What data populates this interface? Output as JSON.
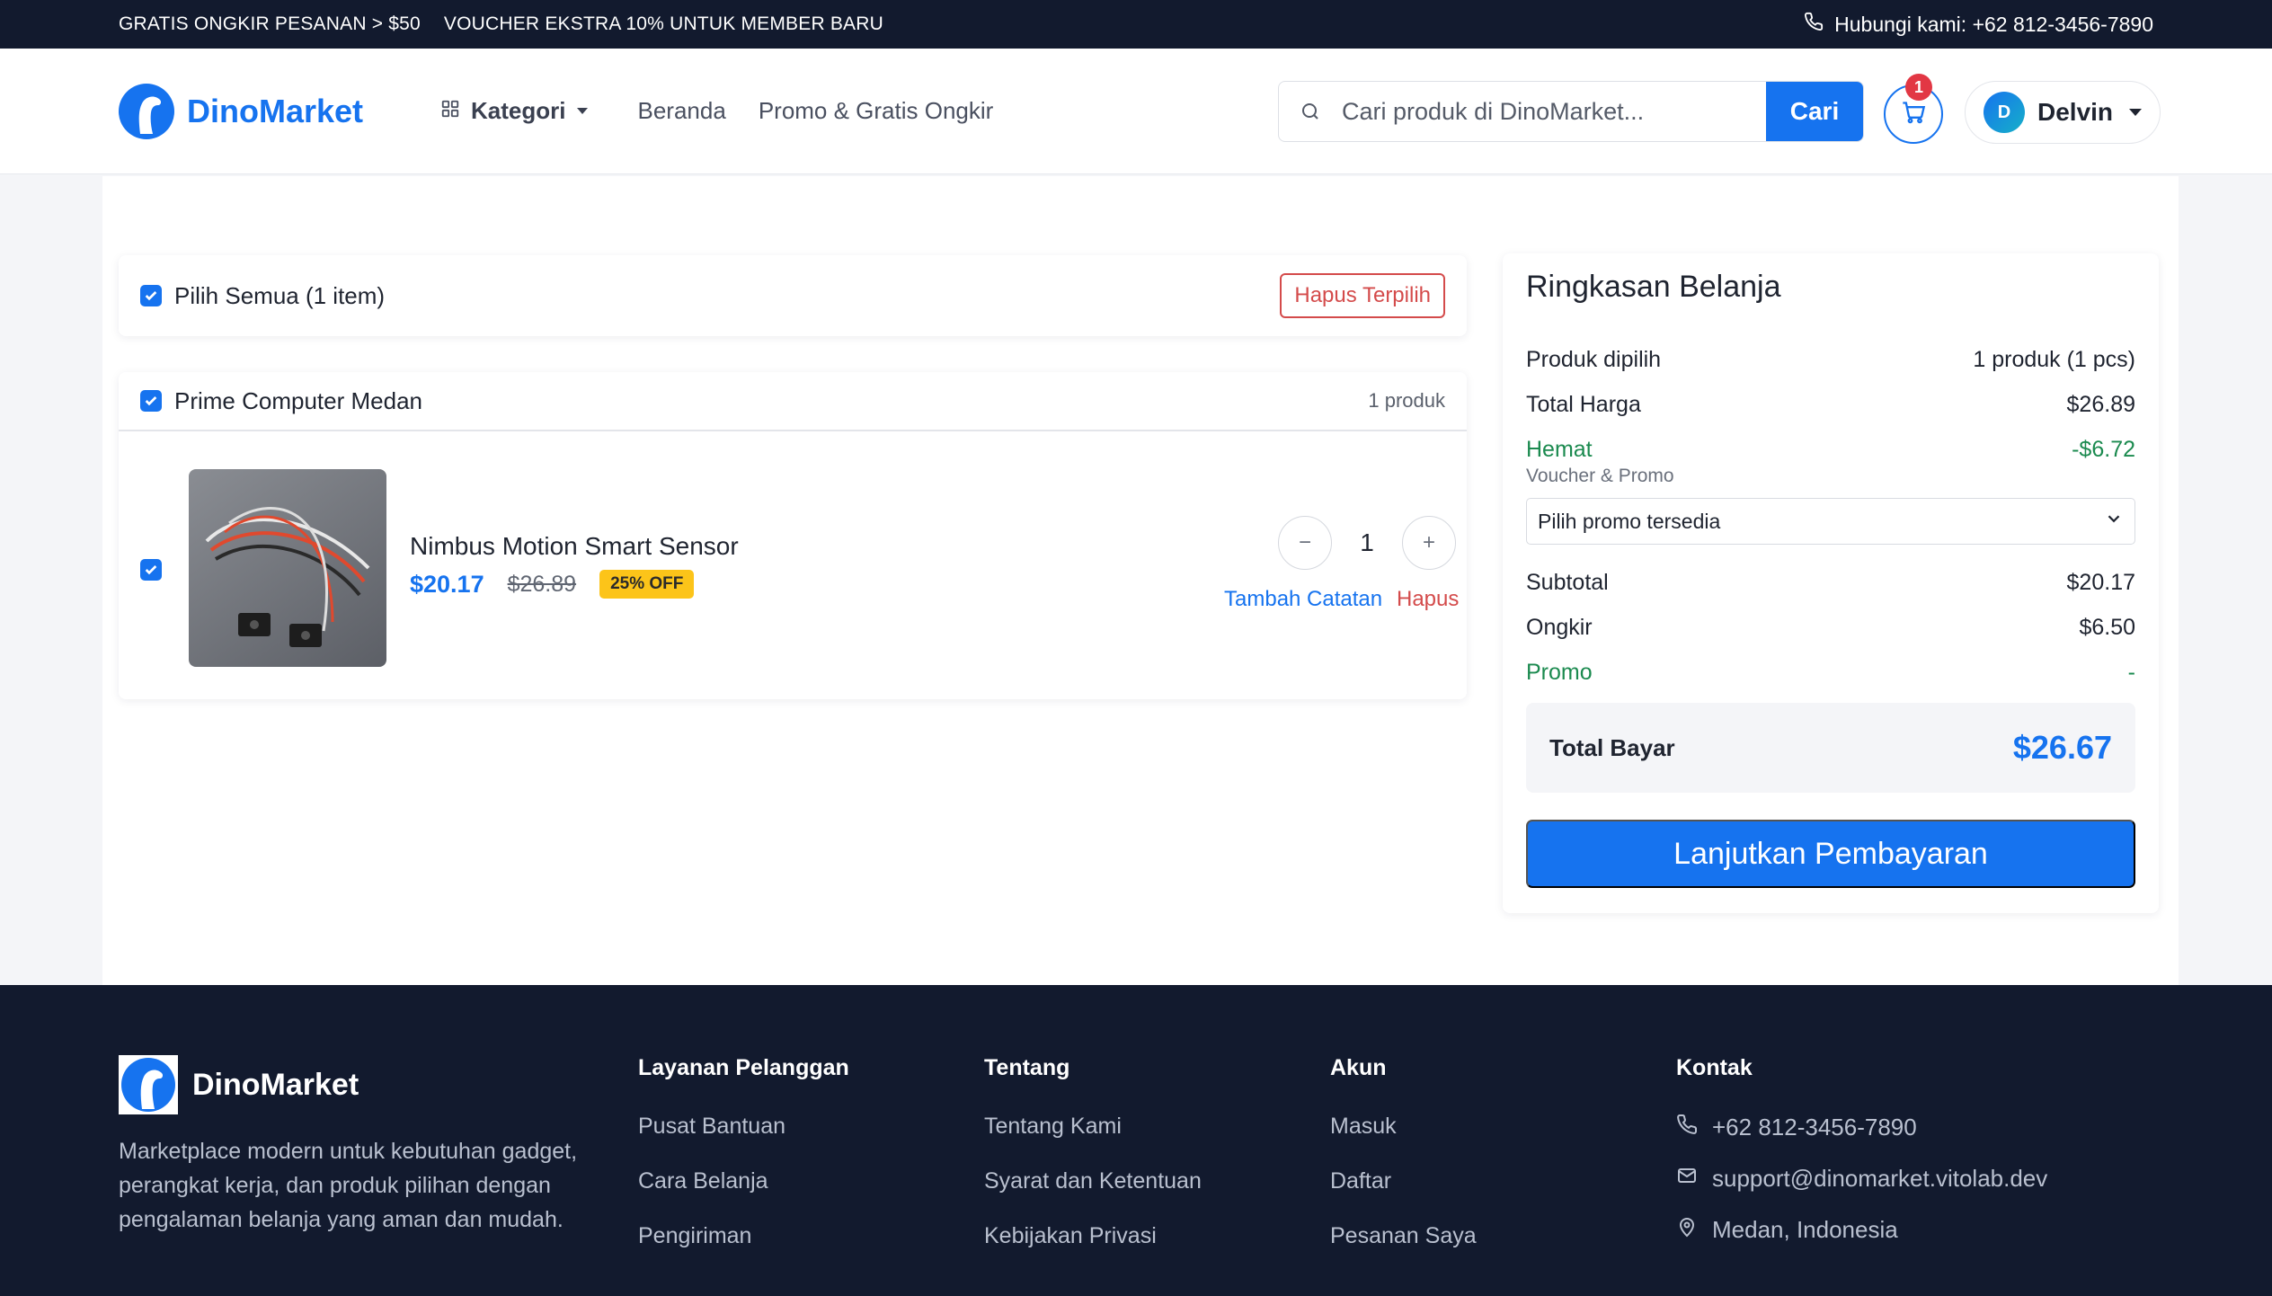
{
  "topbar": {
    "promos": [
      "GRATIS ONGKIR PESANAN > $50",
      "VOUCHER EKSTRA 10% UNTUK MEMBER BARU"
    ],
    "contact": "Hubungi kami: +62 812-3456-7890"
  },
  "header": {
    "brand": "DinoMarket",
    "nav": {
      "kategori": "Kategori",
      "beranda": "Beranda",
      "promo": "Promo & Gratis Ongkir"
    },
    "search": {
      "placeholder": "Cari produk di DinoMarket...",
      "button": "Cari"
    },
    "cart_count": "1",
    "user": {
      "initial": "D",
      "name": "Delvin"
    }
  },
  "cart": {
    "select_all_label": "Pilih Semua (1 item)",
    "delete_selected": "Hapus Terpilih",
    "store": {
      "name": "Prime Computer Medan",
      "count": "1 produk",
      "items": [
        {
          "name": "Nimbus Motion Smart Sensor",
          "price": "$20.17",
          "original_price": "$26.89",
          "discount": "25% OFF",
          "qty": "1",
          "note_label": "Tambah Catatan",
          "delete_label": "Hapus"
        }
      ]
    }
  },
  "summary": {
    "title": "Ringkasan Belanja",
    "rows_top": [
      {
        "label": "Produk dipilih",
        "value": "1 produk (1 pcs)",
        "green": false
      },
      {
        "label": "Total Harga",
        "value": "$26.89",
        "green": false
      },
      {
        "label": "Hemat",
        "value": "-$6.72",
        "green": true
      }
    ],
    "voucher_label": "Voucher & Promo",
    "voucher_select": "Pilih promo tersedia",
    "rows_bottom": [
      {
        "label": "Subtotal",
        "value": "$20.17",
        "green": false
      },
      {
        "label": "Ongkir",
        "value": "$6.50",
        "green": false
      },
      {
        "label": "Promo",
        "value": "-",
        "green": true
      }
    ],
    "total_label": "Total Bayar",
    "total_value": "$26.67",
    "pay_button": "Lanjutkan Pembayaran"
  },
  "footer": {
    "brand": "DinoMarket",
    "description": "Marketplace modern untuk kebutuhan gadget, perangkat kerja, dan produk pilihan dengan pengalaman belanja yang aman dan mudah.",
    "columns": [
      {
        "title": "Layanan Pelanggan",
        "links": [
          "Pusat Bantuan",
          "Cara Belanja",
          "Pengiriman"
        ]
      },
      {
        "title": "Tentang",
        "links": [
          "Tentang Kami",
          "Syarat dan Ketentuan",
          "Kebijakan Privasi"
        ]
      },
      {
        "title": "Akun",
        "links": [
          "Masuk",
          "Daftar",
          "Pesanan Saya"
        ]
      }
    ],
    "contact_title": "Kontak",
    "contact": {
      "phone": "+62 812-3456-7890",
      "email": "support@dinomarket.vitolab.dev",
      "location": "Medan, Indonesia"
    }
  },
  "colors": {
    "primary": "#1673ef",
    "dark": "#121a2e",
    "danger": "#d44b4b",
    "success": "#1b8a4f",
    "badge": "#fcc419"
  }
}
